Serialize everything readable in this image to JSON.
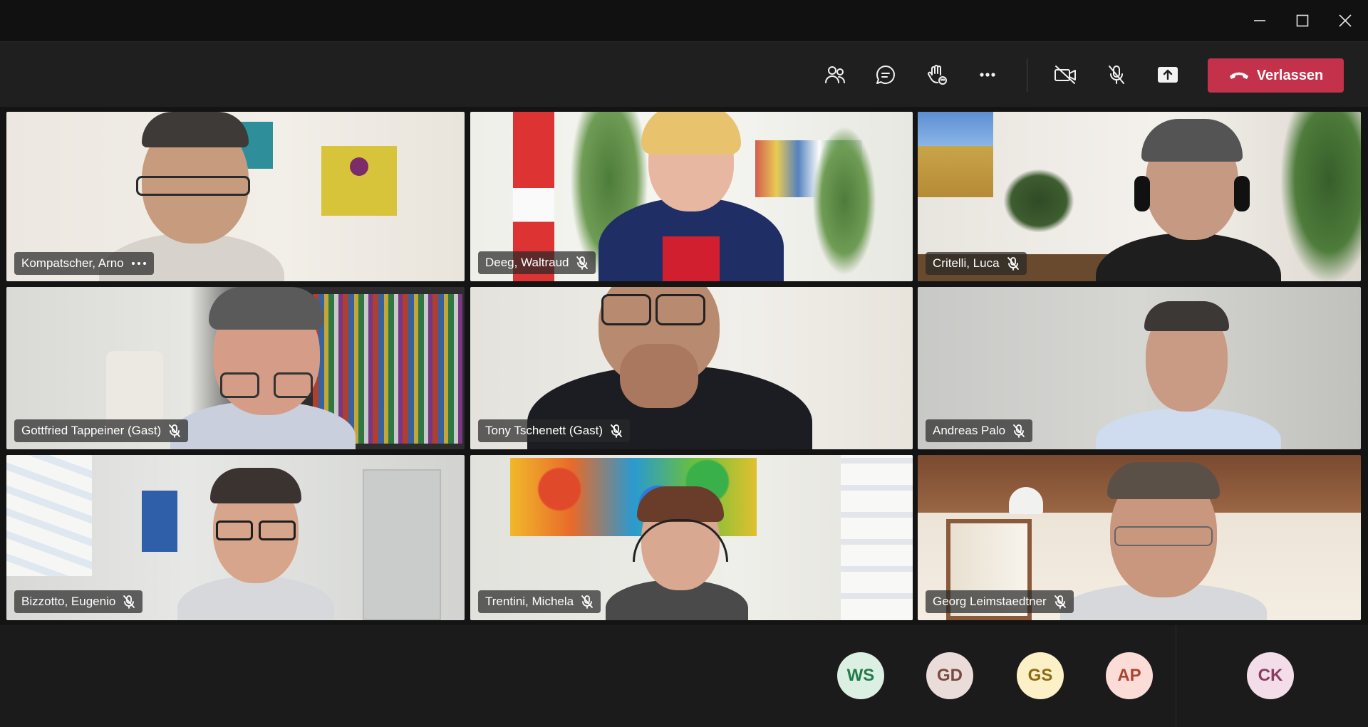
{
  "window": {
    "controls": {
      "minimize": "minimize-icon",
      "maximize": "maximize-icon",
      "close": "close-icon"
    }
  },
  "toolbar": {
    "buttons": [
      "people-icon",
      "chat-icon",
      "raise-hand-icon",
      "more-icon",
      "camera-off-icon",
      "mic-off-icon",
      "share-screen-icon"
    ],
    "leave_label": "Verlassen",
    "leave_color": "#c4314b"
  },
  "participants": [
    {
      "name": "Kompatscher, Arno",
      "status": "more-options-icon"
    },
    {
      "name": "Deeg, Waltraud",
      "status": "mic-off-icon"
    },
    {
      "name": "Critelli, Luca",
      "status": "mic-off-icon"
    },
    {
      "name": "Gottfried Tappeiner (Gast)",
      "status": "mic-off-icon"
    },
    {
      "name": "Tony Tschenett (Gast)",
      "status": "mic-off-icon"
    },
    {
      "name": "Andreas Palo",
      "status": "mic-off-icon"
    },
    {
      "name": "Bizzotto, Eugenio",
      "status": "mic-off-icon"
    },
    {
      "name": "Trentini, Michela",
      "status": "mic-off-icon"
    },
    {
      "name": "Georg Leimstaedtner",
      "status": "mic-off-icon"
    }
  ],
  "overflow_participants": [
    {
      "initials": "WS",
      "bg": "#dcefe3",
      "fg": "#237b4b"
    },
    {
      "initials": "GD",
      "bg": "#eadcd9",
      "fg": "#7a4a3f"
    },
    {
      "initials": "GS",
      "bg": "#fbf0c6",
      "fg": "#8a6a14"
    },
    {
      "initials": "AP",
      "bg": "#fbdcd6",
      "fg": "#a8442f"
    },
    {
      "initials": "CK",
      "bg": "#f2dde8",
      "fg": "#8a3d63"
    }
  ]
}
